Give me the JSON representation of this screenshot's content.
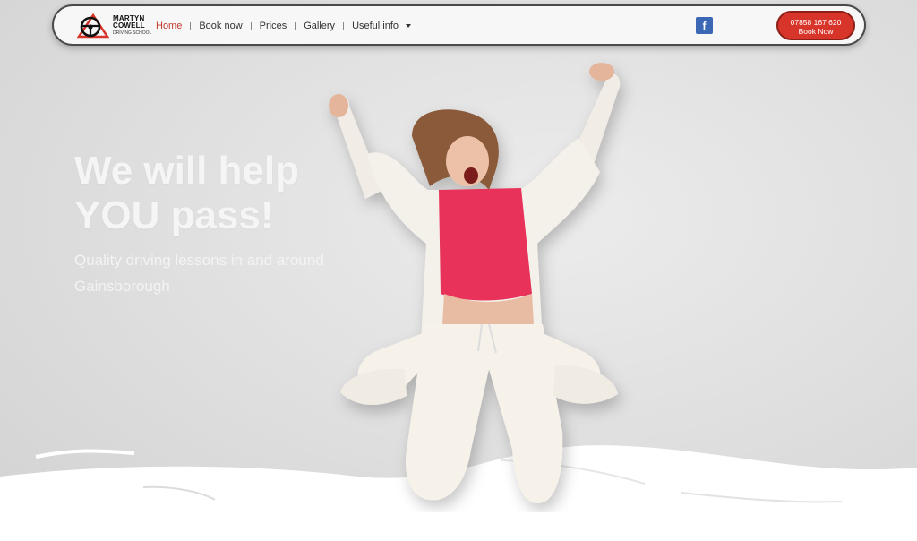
{
  "brand": {
    "line1": "MARTYN",
    "line2": "COWELL",
    "line3": "DRIVING SCHOOL",
    "accent": "#d7352a"
  },
  "nav": {
    "items": [
      {
        "label": "Home",
        "active": true
      },
      {
        "label": "Book now",
        "active": false
      },
      {
        "label": "Prices",
        "active": false
      },
      {
        "label": "Gallery",
        "active": false
      },
      {
        "label": "Useful info",
        "active": false
      }
    ],
    "dropdown_icon": "chevron-down-icon",
    "social_icon": "facebook-icon",
    "social_color": "#3b67b5"
  },
  "cta": {
    "phone": "07858 167 620",
    "label": "Book Now"
  },
  "hero": {
    "headline_line1": "We will help",
    "headline_line2": "YOU pass!",
    "sub_line1": "Quality driving lessons in and around",
    "sub_line2": "Gainsborough"
  }
}
